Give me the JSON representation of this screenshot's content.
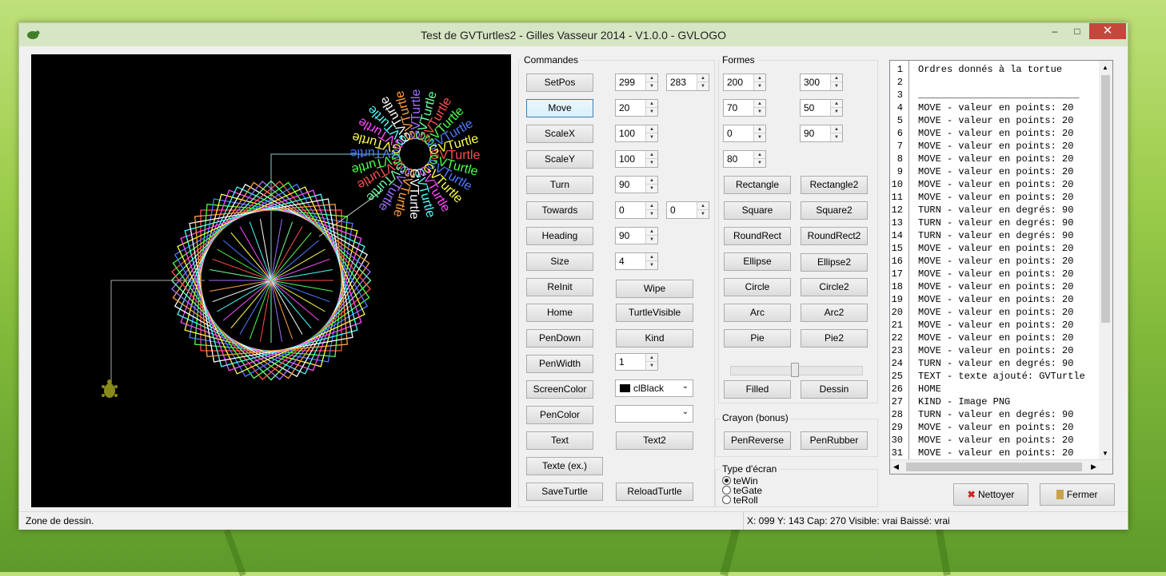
{
  "window": {
    "title": "Test de GVTurtles2 - Gilles Vasseur 2014 - V1.0.0 - GVLOGO",
    "minimize": "–",
    "maximize": "□",
    "close": "✕"
  },
  "groups": {
    "commandes": "Commandes",
    "formes": "Formes",
    "crayon": "Crayon (bonus)",
    "type_ecran": "Type d'écran"
  },
  "commands": {
    "setpos": {
      "label": "SetPos",
      "v1": "299",
      "v2": "283"
    },
    "move": {
      "label": "Move",
      "v1": "20"
    },
    "scalex": {
      "label": "ScaleX",
      "v1": "100"
    },
    "scaley": {
      "label": "ScaleY",
      "v1": "100"
    },
    "turn": {
      "label": "Turn",
      "v1": "90"
    },
    "towards": {
      "label": "Towards",
      "v1": "0",
      "v2": "0"
    },
    "heading": {
      "label": "Heading",
      "v1": "90"
    },
    "size": {
      "label": "Size",
      "v1": "4"
    },
    "reinit": "ReInit",
    "wipe": "Wipe",
    "home": "Home",
    "turtlevisible": "TurtleVisible",
    "pendown": "PenDown",
    "kind": "Kind",
    "penwidth": {
      "label": "PenWidth",
      "v1": "1"
    },
    "screencolor": {
      "label": "ScreenColor",
      "value": "clBlack"
    },
    "pencolor": {
      "label": "PenColor",
      "value": ""
    },
    "text": "Text",
    "text2": "Text2",
    "texte_ex": "Texte (ex.)",
    "saveturtle": "SaveTurtle",
    "reloadturtle": "ReloadTurtle"
  },
  "shapes": {
    "spins": [
      "200",
      "300",
      "70",
      "50",
      "0",
      "90",
      "80"
    ],
    "rectangle": "Rectangle",
    "rectangle2": "Rectangle2",
    "square": "Square",
    "square2": "Square2",
    "roundrect": "RoundRect",
    "roundrect2": "RoundRect2",
    "ellipse": "Ellipse",
    "ellipse2": "Ellipse2",
    "circle": "Circle",
    "circle2": "Circle2",
    "arc": "Arc",
    "arc2": "Arc2",
    "pie": "Pie",
    "pie2": "Pie2",
    "filled": "Filled",
    "dessin": "Dessin",
    "slider_level": 0.5
  },
  "crayon": {
    "penreverse": "PenReverse",
    "penrubber": "PenRubber"
  },
  "screen_types": [
    {
      "label": "teWin",
      "selected": true
    },
    {
      "label": "teGate",
      "selected": false
    },
    {
      "label": "teRoll",
      "selected": false
    }
  ],
  "memo_lines": [
    "Ordres donnés à la tortue",
    "",
    "____________________________",
    "MOVE - valeur en points: 20",
    "MOVE - valeur en points: 20",
    "MOVE - valeur en points: 20",
    "MOVE - valeur en points: 20",
    "MOVE - valeur en points: 20",
    "MOVE - valeur en points: 20",
    "MOVE - valeur en points: 20",
    "MOVE - valeur en points: 20",
    "TURN - valeur en degrés: 90",
    "TURN - valeur en degrés: 90",
    "TURN - valeur en degrés: 90",
    "MOVE - valeur en points: 20",
    "MOVE - valeur en points: 20",
    "MOVE - valeur en points: 20",
    "MOVE - valeur en points: 20",
    "MOVE - valeur en points: 20",
    "MOVE - valeur en points: 20",
    "MOVE - valeur en points: 20",
    "MOVE - valeur en points: 20",
    "MOVE - valeur en points: 20",
    "TURN - valeur en degrés: 90",
    "TEXT - texte ajouté: GVTurtle",
    "HOME",
    "KIND - Image PNG",
    "TURN - valeur en degrés: 90",
    "MOVE - valeur en points: 20",
    "MOVE - valeur en points: 20",
    "MOVE - valeur en points: 20"
  ],
  "buttons": {
    "nettoyer": "Nettoyer",
    "fermer": "Fermer"
  },
  "status": {
    "left": "Zone de dessin.",
    "right": "X: 099 Y: 143 Cap: 270 Visible: vrai Baissé: vrai"
  },
  "canvas_text": "GVTurtle",
  "colors": {
    "canvas": "#000000",
    "titlebar": "#d6e5c4",
    "close": "#c7463c"
  }
}
